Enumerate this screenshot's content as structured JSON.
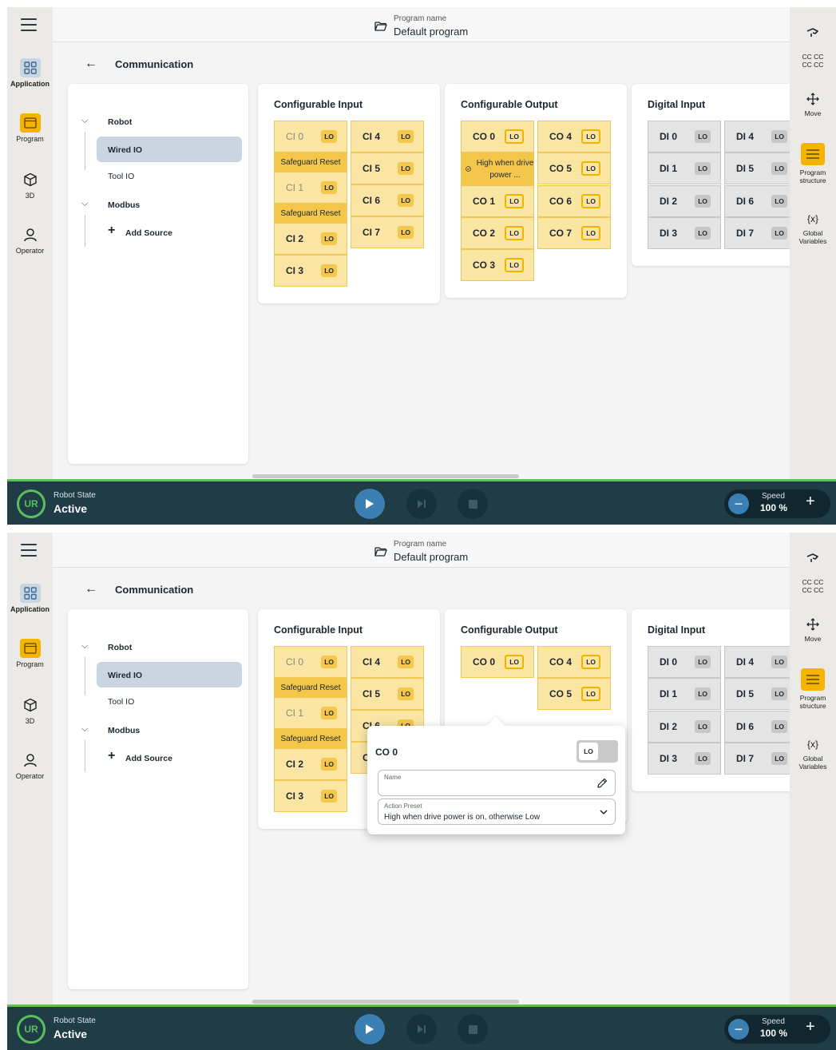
{
  "program": {
    "label": "Program name",
    "name": "Default program"
  },
  "page": {
    "title": "Communication"
  },
  "nav": [
    {
      "label": "Application",
      "icon": "grid-icon"
    },
    {
      "label": "Program",
      "icon": "program-icon"
    },
    {
      "label": "3D",
      "icon": "cube-icon"
    },
    {
      "label": "Operator",
      "icon": "person-icon"
    }
  ],
  "right_nav": {
    "cc": "CC CC\nCC CC",
    "move": "Move",
    "structure": "Program structure",
    "variables": "Global Variables"
  },
  "tree": {
    "robot": "Robot",
    "wired": "Wired IO",
    "tool": "Tool IO",
    "modbus": "Modbus",
    "add": "Add Source"
  },
  "cards": {
    "ci": {
      "title": "Configurable Input",
      "safeguard": "Safeguard Reset",
      "names": [
        "CI 0",
        "CI 1",
        "CI 2",
        "CI 3",
        "CI 4",
        "CI 5",
        "CI 6",
        "CI 7"
      ]
    },
    "co": {
      "title": "Configurable Output",
      "high_when": "High when drive power ...",
      "names": [
        "CO 0",
        "CO 1",
        "CO 2",
        "CO 3",
        "CO 4",
        "CO 5",
        "CO 6",
        "CO 7"
      ]
    },
    "di": {
      "title": "Digital Input",
      "names": [
        "DI 0",
        "DI 1",
        "DI 2",
        "DI 3",
        "DI 4",
        "DI 5",
        "DI 6",
        "DI 7"
      ]
    },
    "state_label": "LO"
  },
  "popover": {
    "title": "CO 0",
    "toggle": "LO",
    "name_label": "Name",
    "name_value": "",
    "preset_label": "Action Preset",
    "preset_value": "High when drive power is on, otherwise Low"
  },
  "footer": {
    "state_label": "Robot State",
    "state_value": "Active",
    "speed_label": "Speed",
    "speed_value": "100 %"
  },
  "colors": {
    "accent": "#f4b400",
    "blue": "#3b7fb3",
    "bottom": "#1f3c47",
    "ok": "#5bbf5b"
  }
}
